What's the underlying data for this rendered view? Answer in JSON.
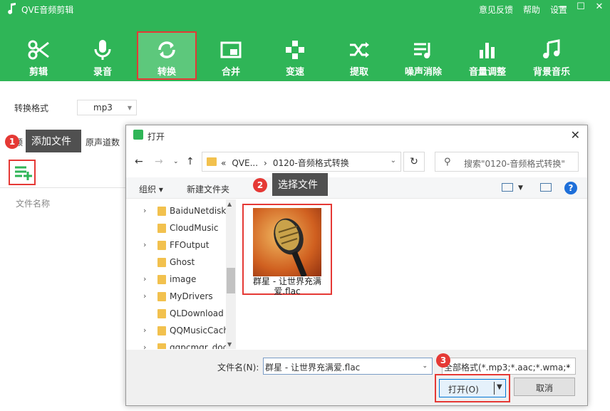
{
  "app": {
    "title": "QVE音频剪辑",
    "links": [
      "意见反馈",
      "帮助",
      "设置"
    ],
    "window_controls": [
      "—",
      "☐",
      "✕"
    ]
  },
  "toolbar": {
    "items": [
      {
        "label": "剪辑",
        "icon": "scissors-icon"
      },
      {
        "label": "录音",
        "icon": "microphone-icon"
      },
      {
        "label": "转换",
        "icon": "convert-icon",
        "active": true
      },
      {
        "label": "合并",
        "icon": "merge-icon"
      },
      {
        "label": "变速",
        "icon": "speed-icon"
      },
      {
        "label": "提取",
        "icon": "extract-icon"
      },
      {
        "label": "噪声消除",
        "icon": "denoise-icon"
      },
      {
        "label": "音量调整",
        "icon": "volume-icon"
      },
      {
        "label": "背景音乐",
        "icon": "music-note-icon"
      }
    ]
  },
  "convert": {
    "format_label": "转换格式",
    "format_value": "mp3",
    "channel_value": "原声道数",
    "hidden_label": "音频"
  },
  "tooltips": {
    "add_file": "添加文件",
    "select_file": "选择文件"
  },
  "steps": [
    "1",
    "2",
    "3"
  ],
  "file_list": {
    "column_filename": "文件名称"
  },
  "dialog": {
    "title": "打开",
    "breadcrumbs": [
      "«",
      "QVE...",
      "›",
      "0120-音频格式转换",
      "›"
    ],
    "search_placeholder": "搜索\"0120-音频格式转换\"",
    "organize": "组织 ▾",
    "new_folder": "新建文件夹",
    "tree": [
      "BaiduNetdisk",
      "CloudMusic",
      "FFOutput",
      "Ghost",
      "image",
      "MyDrivers",
      "QLDownload",
      "QQMusicCach",
      "qqpcmgr_doc"
    ],
    "file": {
      "name": "群星 - 让世界充满爱.flac"
    },
    "filename_label": "文件名(N):",
    "filename_value": "群星 - 让世界充满爱.flac",
    "filetype_value": "全部格式(*.mp3;*.aac;*.wma;*",
    "open_button": "打开(O)",
    "cancel_button": "取消"
  }
}
